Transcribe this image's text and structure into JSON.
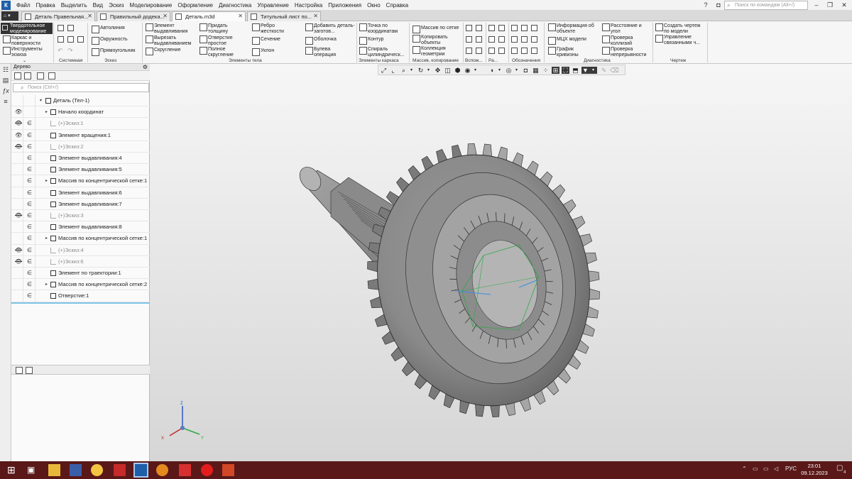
{
  "menubar": {
    "items": [
      "Файл",
      "Правка",
      "Выделить",
      "Вид",
      "Эскиз",
      "Моделирование",
      "Оформление",
      "Диагностика",
      "Управление",
      "Настройка",
      "Приложения",
      "Окно",
      "Справка"
    ],
    "search_placeholder": "Поиск по командам (Alt+/)"
  },
  "tabs": [
    {
      "label": "Деталь Правельная..."
    },
    {
      "label": "Правильный додека..."
    },
    {
      "label": "Деталь.m3d"
    },
    {
      "label": "Титульный лист по..."
    }
  ],
  "ribbon": {
    "mode_solid": "Твердотельное моделирование",
    "mode_frame": "Каркас и поверхности",
    "mode_sketch_tools": "Инструменты эскиза",
    "sketch": [
      "Автолиния",
      "Окружность",
      "Прямоугольник"
    ],
    "body_col1": [
      "Элемент выдавливания",
      "Вырезать выдавливанием",
      "Скругление"
    ],
    "body_col2": [
      "Придать толщину",
      "Отверстие простое",
      "Полное скругление"
    ],
    "body_col3": [
      "Ребро жесткости",
      "Сечение",
      "Уклон"
    ],
    "body_col4": [
      "Добавить деталь-заготов...",
      "Оболочка",
      "Булева операция"
    ],
    "frame": [
      "Точка по координатам",
      "Контур",
      "Спираль цилиндрическ..."
    ],
    "array": [
      "Массив по сетке",
      "Копировать объекты",
      "Коллекция геометрии"
    ],
    "diag_col1": [
      "Информация об объекте",
      "МЦХ модели",
      "График кривизны"
    ],
    "diag_col2": [
      "Расстояние и угол",
      "Проверка коллизий",
      "Проверка непрерывности"
    ],
    "drawing": [
      "Создать чертеж по модели",
      "Управление связанными ч..."
    ],
    "groups": [
      "Системная",
      "Эскиз",
      "Элементы тела",
      "Элементы каркаса",
      "Массив, копирование",
      "Вспом...",
      "Ра...",
      "Обозначения",
      "Диагностика",
      "Чертеж"
    ]
  },
  "tree": {
    "title": "Дерево",
    "search_placeholder": "Поиск (Ctrl+/)",
    "root": "Деталь (Тел-1)",
    "items": [
      {
        "label": "Начало координат",
        "eye": true,
        "expand": true,
        "grey": false
      },
      {
        "label": "(+)Эскиз:1",
        "eye": false,
        "expand": false,
        "grey": true
      },
      {
        "label": "Элемент вращения:1",
        "eye": true,
        "expand": false,
        "grey": false
      },
      {
        "label": "(+)Эскиз:2",
        "eye": false,
        "expand": false,
        "grey": true
      },
      {
        "label": "Элемент выдавливания:4",
        "eye": false,
        "expand": false,
        "grey": false
      },
      {
        "label": "Элемент выдавливания:5",
        "eye": false,
        "expand": false,
        "grey": false
      },
      {
        "label": "Массив по концентрической сетке:1",
        "eye": false,
        "expand": true,
        "grey": false
      },
      {
        "label": "Элемент выдавливания:6",
        "eye": false,
        "expand": false,
        "grey": false
      },
      {
        "label": "Элемент выдавливания:7",
        "eye": false,
        "expand": false,
        "grey": false
      },
      {
        "label": "(+)Эскиз:3",
        "eye": false,
        "expand": false,
        "grey": true
      },
      {
        "label": "Элемент выдавливания:8",
        "eye": false,
        "expand": false,
        "grey": false
      },
      {
        "label": "Массив по концентрической сетке:1",
        "eye": false,
        "expand": true,
        "grey": false
      },
      {
        "label": "(+)Эскиз:4",
        "eye": false,
        "expand": false,
        "grey": true
      },
      {
        "label": "(+)Эскиз:6",
        "eye": false,
        "expand": false,
        "grey": true
      },
      {
        "label": "Элемент по траектории:1",
        "eye": false,
        "expand": false,
        "grey": false
      },
      {
        "label": "Массив по концентрической сетке:2",
        "eye": false,
        "expand": true,
        "grey": false
      },
      {
        "label": "Отверстие:1",
        "eye": false,
        "expand": false,
        "grey": false
      }
    ]
  },
  "axes": {
    "x": "X",
    "y": "Y",
    "z": "Z"
  },
  "taskbar": {
    "lang": "РУС",
    "time": "23:01",
    "date": "09.12.2023",
    "badge": "4"
  },
  "colors": {
    "taskbar": "#5a1818",
    "accent": "#1d5fa8",
    "tree_divider": "#7ec3e5"
  }
}
